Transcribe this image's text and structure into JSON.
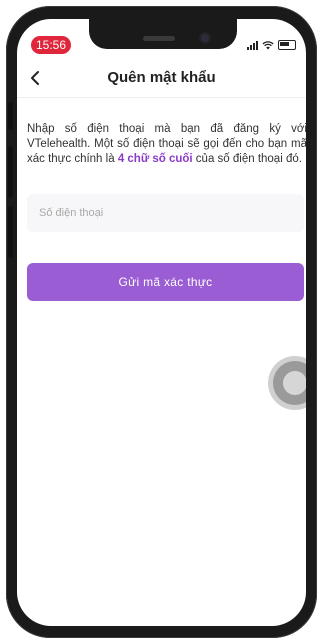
{
  "status_bar": {
    "time": "15:56"
  },
  "header": {
    "title": "Quên mật khẩu"
  },
  "instruction": {
    "text_before": "Nhập số điện thoại mà bạn đã đăng ký với VTelehealth. Một số điện thoại sẽ gọi đến cho bạn mã xác thực chính là ",
    "highlight": "4 chữ số cuối",
    "text_after": " của số điện thoại đó."
  },
  "phone_field": {
    "placeholder": "Số điện thoại",
    "value": ""
  },
  "send_button": {
    "label": "Gửi mã xác thực"
  },
  "colors": {
    "accent": "#9b5dd3",
    "highlight": "#8b3cc7",
    "status_time_bg": "#e0263a"
  },
  "icons": {
    "back": "chevron-left-icon",
    "signal": "signal-icon",
    "wifi": "wifi-icon",
    "battery": "battery-icon",
    "assistive": "assistive-touch-icon"
  }
}
